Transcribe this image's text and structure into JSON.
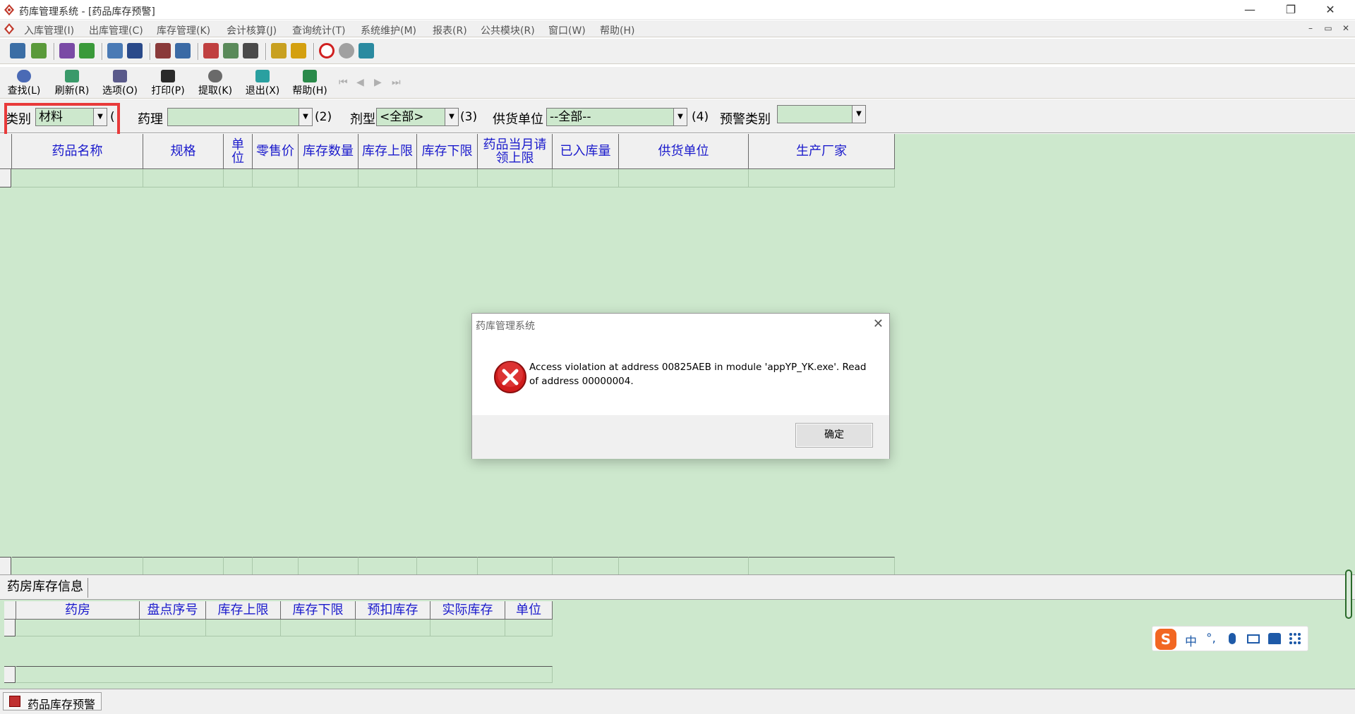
{
  "window": {
    "title": "药库管理系统 - [药品库存预警]",
    "minimize": "—",
    "restore": "❐",
    "close": "✕"
  },
  "menu": {
    "items": [
      "入库管理(I)",
      "出库管理(C)",
      "库存管理(K)",
      "会计核算(J)",
      "查询统计(T)",
      "系统维护(M)",
      "报表(R)",
      "公共模块(R)",
      "窗口(W)",
      "帮助(H)"
    ],
    "mdi_min": "–",
    "mdi_restore": "▭",
    "mdi_close": "✕"
  },
  "toolbar": {
    "buttons": [
      {
        "label": "查找(L)",
        "icon": "search-icon"
      },
      {
        "label": "刷新(R)",
        "icon": "refresh-icon"
      },
      {
        "label": "选项(O)",
        "icon": "options-icon"
      },
      {
        "label": "打印(P)",
        "icon": "print-icon"
      },
      {
        "label": "提取(K)",
        "icon": "extract-icon"
      },
      {
        "label": "退出(X)",
        "icon": "exit-icon"
      },
      {
        "label": "帮助(H)",
        "icon": "help-icon"
      }
    ],
    "nav": [
      "⏮",
      "◀",
      "▶",
      "⏭"
    ]
  },
  "filters": {
    "category_label": "类别",
    "category_value": "材料",
    "category_num": "(",
    "pharmacology_label": "药理",
    "pharmacology_value": "",
    "pharmacology_num": "(2)",
    "dosage_label": "剂型",
    "dosage_value": "<全部>",
    "dosage_num": "(3)",
    "supplier_label": "供货单位",
    "supplier_value": "--全部--",
    "supplier_num": "(4)",
    "alert_label": "预警类别",
    "alert_value": ""
  },
  "main_table": {
    "columns": [
      "药品名称",
      "规格",
      "单位",
      "零售价",
      "库存数量",
      "库存上限",
      "库存下限",
      "药品当月请领上限",
      "已入库量",
      "供货单位",
      "生产厂家"
    ]
  },
  "lower": {
    "tab": "药房库存信息",
    "columns": [
      "药房",
      "盘点序号",
      "库存上限",
      "库存下限",
      "预扣库存",
      "实际库存",
      "单位"
    ]
  },
  "statusbar": {
    "doc_tab": "药品库存预警"
  },
  "dialog": {
    "title": "药库管理系统",
    "close": "✕",
    "message": "Access violation at address 00825AEB in module 'appYP_YK.exe'. Read of address 00000004.",
    "ok": "确定"
  },
  "ime": {
    "logo": "S",
    "mode": "中",
    "punct": "°,"
  },
  "colors": {
    "grid_bg": "#cde8cd",
    "header_text": "#1a1acc",
    "highlight": "#e83a3a",
    "error": "#d01c1c"
  }
}
